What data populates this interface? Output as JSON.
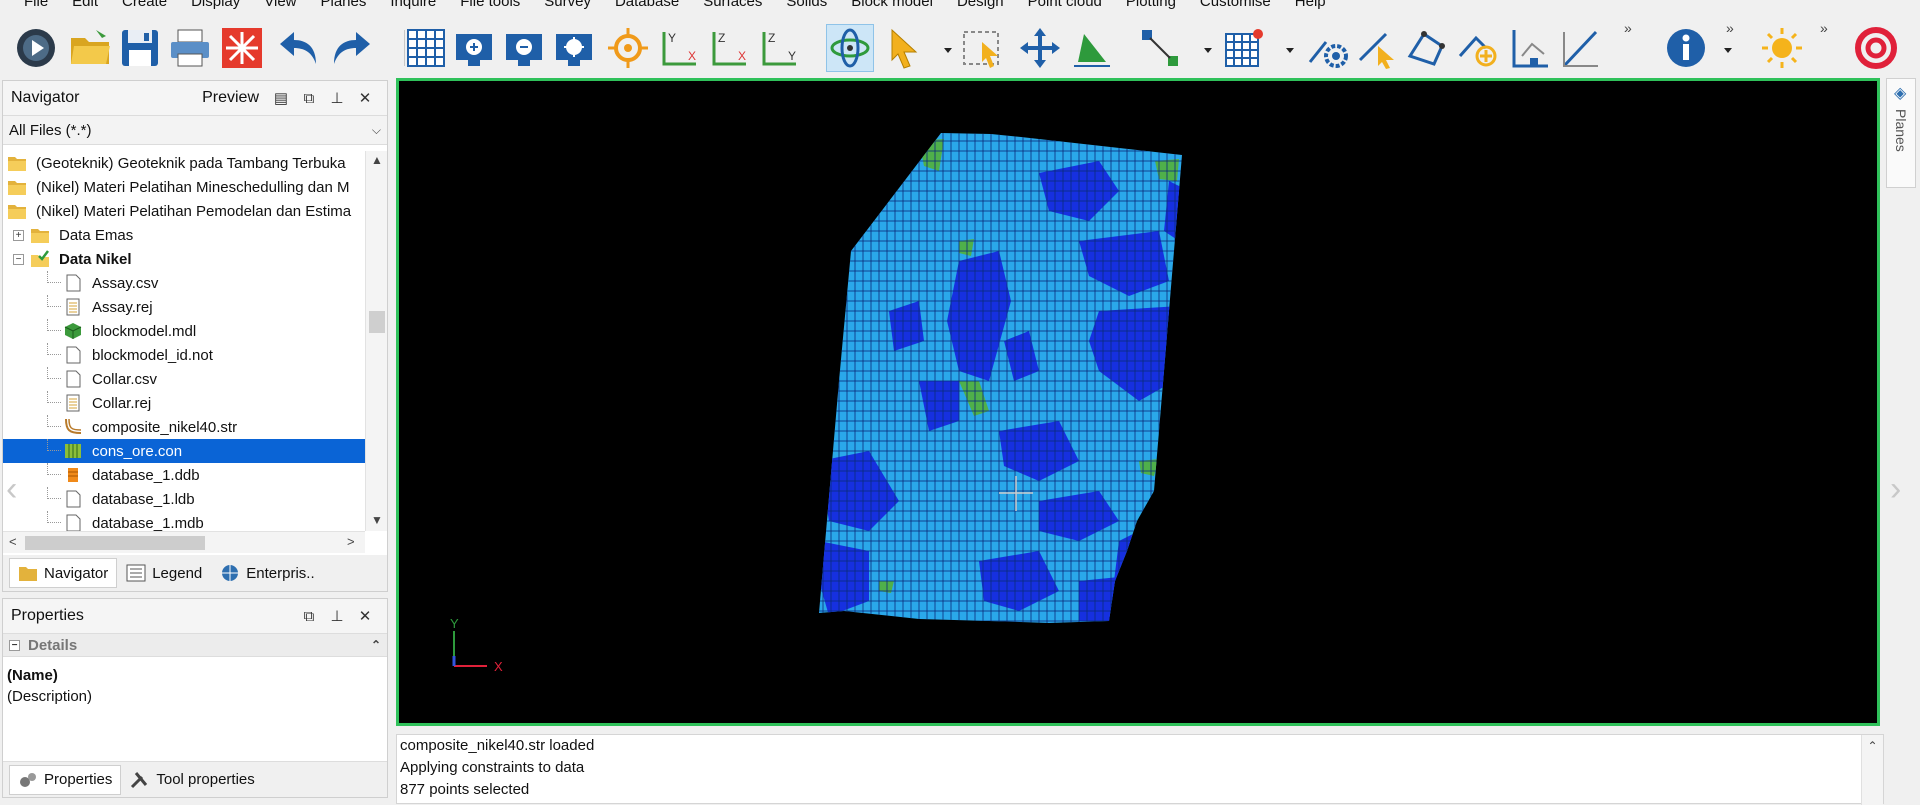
{
  "menu": [
    "File",
    "Edit",
    "Create",
    "Display",
    "View",
    "Planes",
    "Inquire",
    "File tools",
    "Survey",
    "Database",
    "Surfaces",
    "Solids",
    "Block model",
    "Design",
    "Point cloud",
    "Plotting",
    "Customise",
    "Help"
  ],
  "toolbar": {
    "more_glyph": "»",
    "buttons": [
      "start-menu",
      "open-folder",
      "save",
      "print",
      "reset",
      "undo",
      "redo",
      "grid",
      "zoom-in",
      "zoom-out",
      "zoom-extents",
      "target",
      "plane-yx",
      "plane-zx",
      "plane-zy",
      "rotate",
      "select",
      "select-box",
      "pan",
      "triangle",
      "move-point",
      "grid-mark",
      "settings",
      "pointer",
      "polygon",
      "add-point",
      "dimension",
      "slope",
      "info",
      "brightness",
      "stop"
    ]
  },
  "navigator": {
    "title": "Navigator",
    "preview_label": "Preview",
    "filter_text": "All Files (*.*)",
    "tree": [
      {
        "label": "(Geoteknik) Geoteknik pada Tambang Terbuka",
        "level": 0,
        "icon": "folder"
      },
      {
        "label": "(Nikel) Materi Pelatihan Mineschedulling dan M",
        "level": 0,
        "icon": "folder"
      },
      {
        "label": "(Nikel) Materi Pelatihan Pemodelan dan Estima",
        "level": 0,
        "icon": "folder"
      },
      {
        "label": "Data Emas",
        "level": 1,
        "icon": "folder",
        "expander": "+"
      },
      {
        "label": "Data Nikel",
        "level": 1,
        "icon": "folder-check",
        "expander": "−",
        "bold": true
      },
      {
        "label": "Assay.csv",
        "level": 2,
        "icon": "file"
      },
      {
        "label": "Assay.rej",
        "level": 2,
        "icon": "file-lined"
      },
      {
        "label": "blockmodel.mdl",
        "level": 2,
        "icon": "cube"
      },
      {
        "label": "blockmodel_id.not",
        "level": 2,
        "icon": "file"
      },
      {
        "label": "Collar.csv",
        "level": 2,
        "icon": "file"
      },
      {
        "label": "Collar.rej",
        "level": 2,
        "icon": "file-lined"
      },
      {
        "label": "composite_nikel40.str",
        "level": 2,
        "icon": "string"
      },
      {
        "label": "cons_ore.con",
        "level": 2,
        "icon": "cons",
        "selected": true
      },
      {
        "label": "database_1.ddb",
        "level": 2,
        "icon": "database"
      },
      {
        "label": "database_1.ldb",
        "level": 2,
        "icon": "file"
      },
      {
        "label": "database_1.mdb",
        "level": 2,
        "icon": "file"
      }
    ],
    "tabs": [
      "Navigator",
      "Legend",
      "Enterpris.."
    ]
  },
  "properties": {
    "title": "Properties",
    "section": "Details",
    "name_label": "(Name)",
    "description_label": "(Description)",
    "tabs": [
      "Properties",
      "Tool properties"
    ]
  },
  "viewport": {
    "axis_y": "Y",
    "axis_x": "X",
    "border_color": "#2fc15a",
    "model_colors": {
      "light": "#2aa8ea",
      "dark": "#1630e0",
      "green": "#4fb04a"
    }
  },
  "planes_tab": "Planes",
  "log": [
    "composite_nikel40.str loaded",
    "Applying constraints to data",
    "877 points selected"
  ]
}
